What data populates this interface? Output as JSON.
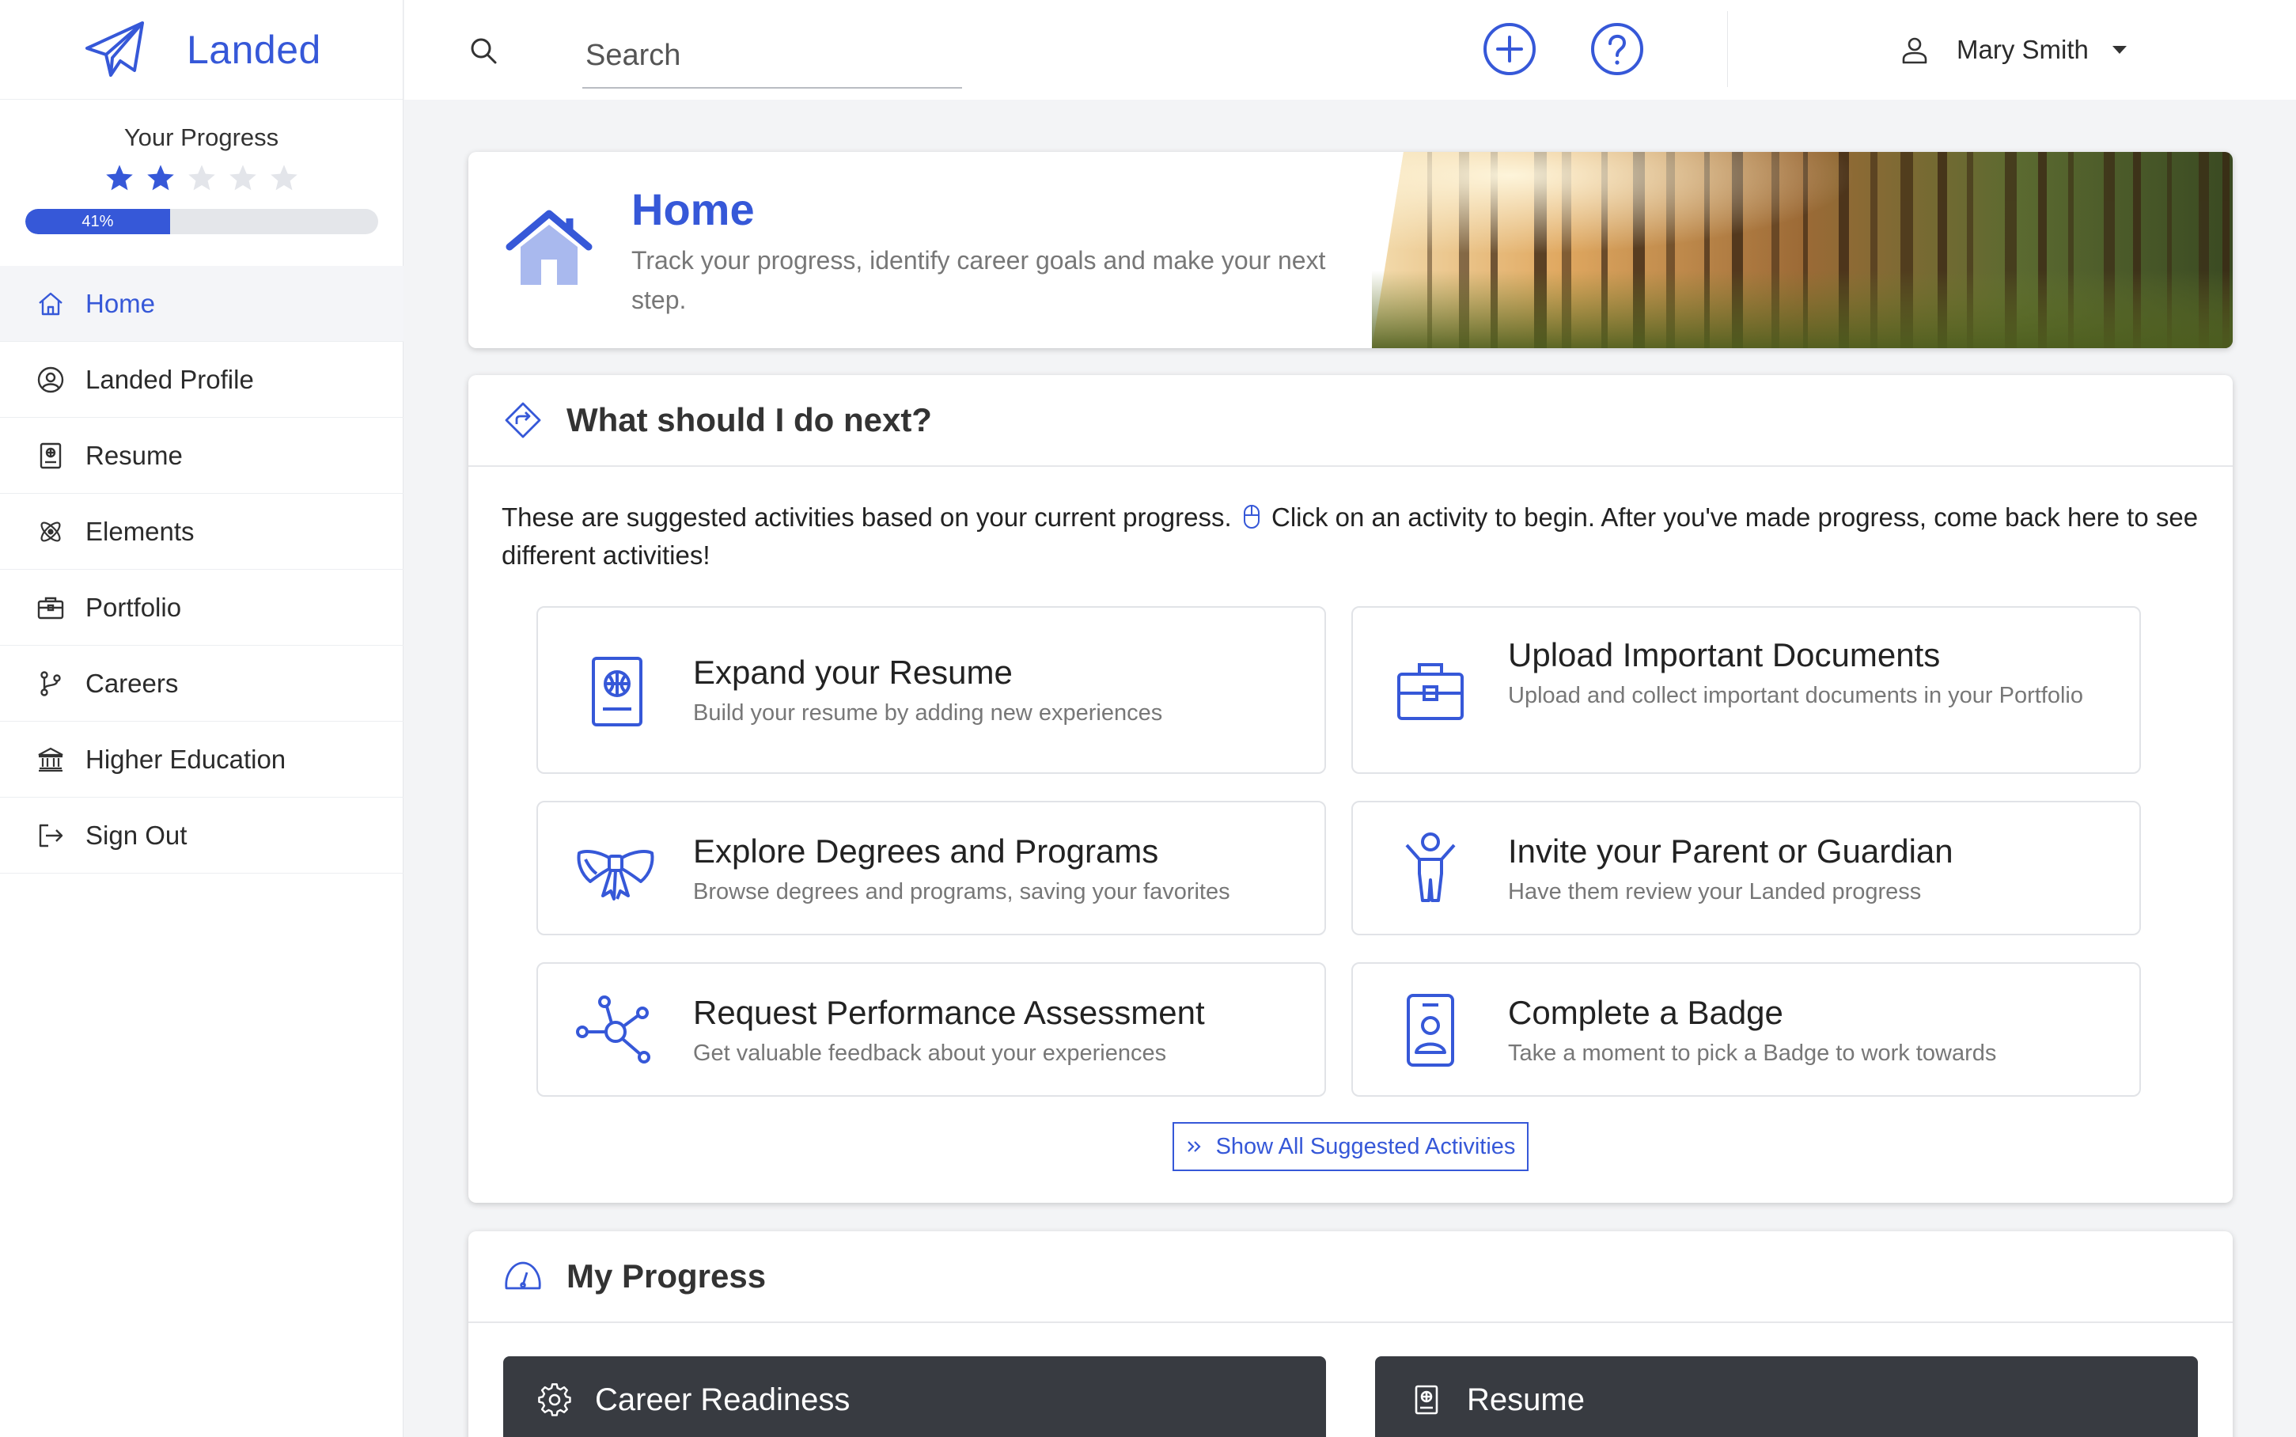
{
  "app": {
    "name": "Landed",
    "accent": "#3658d8",
    "icon": "paper-plane-icon"
  },
  "sidebar": {
    "progress_title": "Your Progress",
    "stars_filled": 2,
    "stars_total": 5,
    "progress_percent": 41,
    "progress_label": "41%",
    "items": [
      {
        "label": "Home",
        "icon": "home-icon",
        "active": true
      },
      {
        "label": "Landed Profile",
        "icon": "user-circle-icon",
        "active": false
      },
      {
        "label": "Resume",
        "icon": "resume-icon",
        "active": false
      },
      {
        "label": "Elements",
        "icon": "atom-icon",
        "active": false
      },
      {
        "label": "Portfolio",
        "icon": "briefcase-icon",
        "active": false
      },
      {
        "label": "Careers",
        "icon": "branch-icon",
        "active": false
      },
      {
        "label": "Higher Education",
        "icon": "university-icon",
        "active": false
      },
      {
        "label": "Sign Out",
        "icon": "sign-out-icon",
        "active": false
      }
    ]
  },
  "topbar": {
    "search_placeholder": "Search",
    "add_icon": "plus-circle-icon",
    "help_icon": "question-circle-icon",
    "user_name": "Mary Smith"
  },
  "hero": {
    "title": "Home",
    "subtitle": "Track your progress, identify career goals and make your next step."
  },
  "next": {
    "title": "What should I do next?",
    "desc_before": "These are suggested activities based on your current progress.",
    "desc_after": "Click on an activity to begin. After you've made progress, come back here to see different activities!",
    "tiles": [
      {
        "title": "Expand your Resume",
        "subtitle": "Build your resume by adding new experiences",
        "icon": "resume-icon"
      },
      {
        "title": "Upload Important Documents",
        "subtitle": "Upload and collect important documents in your Portfolio",
        "icon": "briefcase-icon"
      },
      {
        "title": "Explore Degrees and Programs",
        "subtitle": "Browse degrees and programs, saving your favorites",
        "icon": "ribbon-icon"
      },
      {
        "title": "Invite your Parent or Guardian",
        "subtitle": "Have them review your Landed progress",
        "icon": "person-icon"
      },
      {
        "title": "Request Performance Assessment",
        "subtitle": "Get valuable feedback about your experiences",
        "icon": "network-icon"
      },
      {
        "title": "Complete a Badge",
        "subtitle": "Take a moment to pick a Badge to work towards",
        "icon": "badge-icon"
      }
    ],
    "show_all_label": "Show All Suggested Activities"
  },
  "my_progress": {
    "title": "My Progress",
    "panels": [
      {
        "title": "Career Readiness",
        "icon": "gear-icon"
      },
      {
        "title": "Resume",
        "icon": "resume-icon"
      }
    ]
  }
}
